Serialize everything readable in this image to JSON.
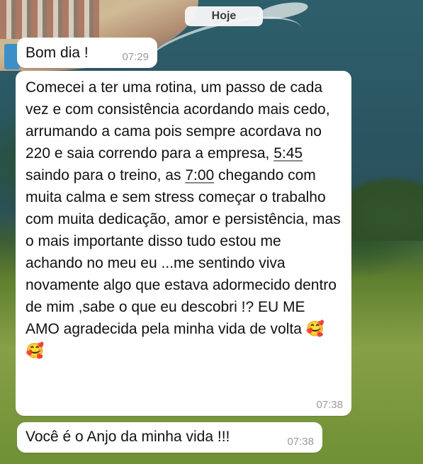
{
  "chat": {
    "date_label": "Hoje",
    "messages": [
      {
        "text": "Bom dia !",
        "time": "07:29"
      },
      {
        "segments": [
          "Comecei a ter uma rotina, um passo de cada vez  e com consistência acordando mais cedo, arrumando a cama pois sempre acordava no 220 e saia correndo para a empresa, ",
          "5:45",
          " saindo para o treino, as ",
          "7:00",
          " chegando com muita calma e sem stress começar o trabalho com muita dedicação, amor e persistência, mas o mais importante disso tudo estou me achando no meu eu ...me sentindo viva novamente algo que estava adormecido  dentro de mim ,sabe o que eu descobri !? EU ME AMO  agradecida pela minha vida de volta "
        ],
        "emoji": "🥰🥰",
        "time": "07:38"
      },
      {
        "text": "Você é o Anjo da minha vida !!!",
        "time": "07:38"
      }
    ]
  },
  "icons": {
    "emoji": "smiling-face-with-hearts-icon"
  },
  "colors": {
    "bubble": "#ffffff",
    "timestamp": "#9a9a9a",
    "date_pill": "#f6f6f6"
  }
}
